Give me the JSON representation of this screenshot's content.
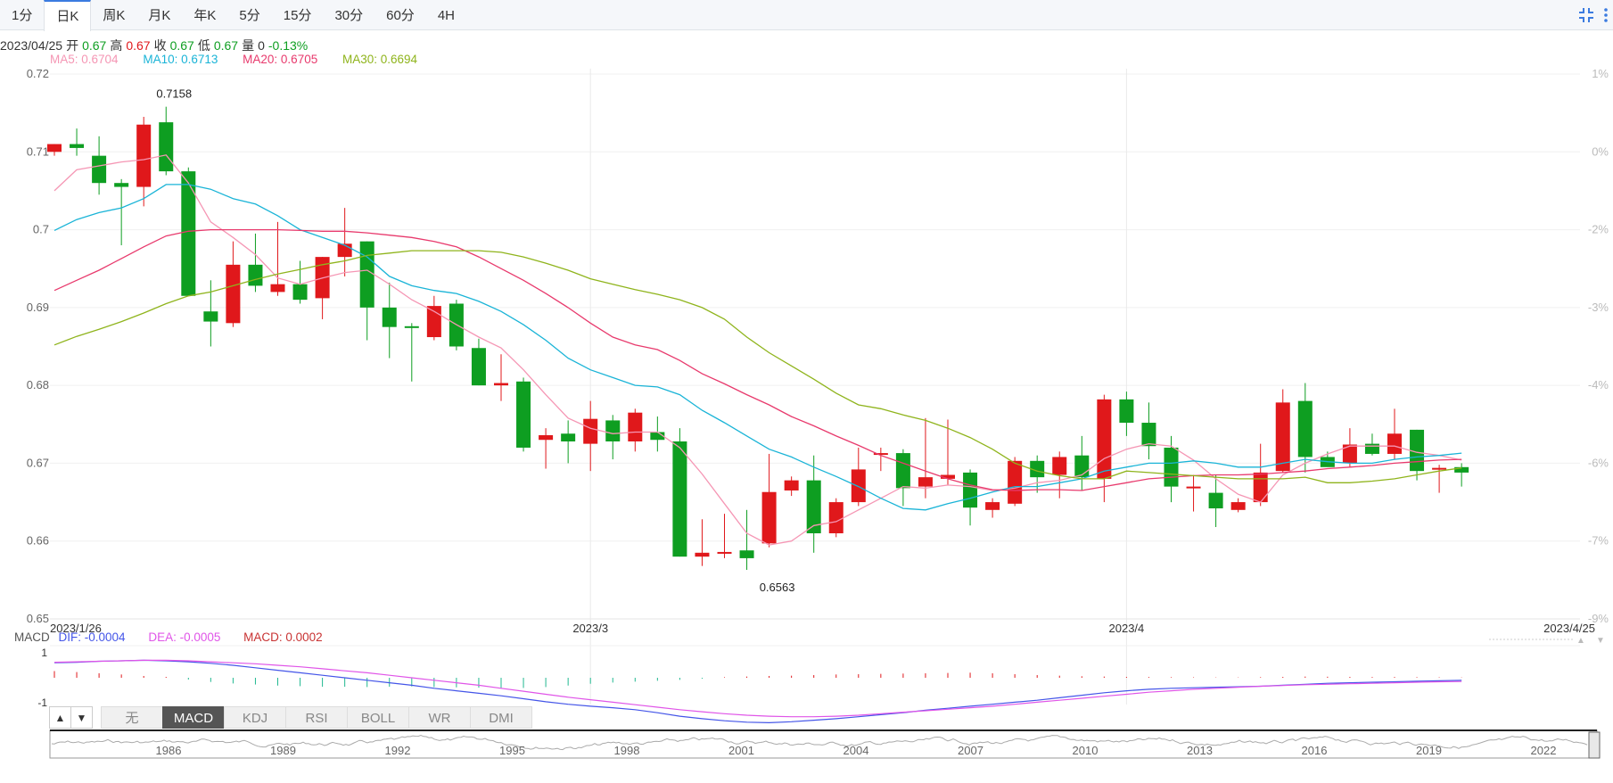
{
  "toolbar": {
    "tabs": [
      "1分",
      "日K",
      "周K",
      "月K",
      "年K",
      "5分",
      "15分",
      "30分",
      "60分",
      "4H"
    ],
    "active": "日K",
    "icons": [
      "collapse-icon",
      "more-icon"
    ]
  },
  "info": {
    "date": "2023/04/25",
    "open_label": "开",
    "open": "0.67",
    "high_label": "高",
    "high": "0.67",
    "close_label": "收",
    "close": "0.67",
    "low_label": "低",
    "low": "0.67",
    "vol_label": "量",
    "vol": "0",
    "change": "-0.13%"
  },
  "ma": {
    "ma5": "MA5: 0.6704",
    "ma10": "MA10: 0.6713",
    "ma20": "MA20: 0.6705",
    "ma30": "MA30: 0.6694"
  },
  "colors": {
    "up": "#e0181b",
    "down": "#0e9e21",
    "ma5": "#f596b4",
    "ma10": "#1ab4d7",
    "ma20": "#e83a6d",
    "ma30": "#8fb41c",
    "dif": "#4455e8",
    "dea": "#e055e8",
    "macd_label": "#c83232"
  },
  "macd": {
    "title": "MACD",
    "dif": "DIF: -0.0004",
    "dea": "DEA: -0.0005",
    "macd": "MACD: 0.0002",
    "yticks": [
      "1",
      "-1"
    ]
  },
  "indicators": {
    "buttons": [
      "无",
      "MACD",
      "KDJ",
      "RSI",
      "BOLL",
      "WR",
      "DMI"
    ],
    "active": "MACD",
    "arrows": [
      "▲",
      "▼"
    ]
  },
  "navigator": {
    "labels": [
      "1986",
      "1989",
      "1992",
      "1995",
      "1998",
      "2001",
      "2004",
      "2007",
      "2010",
      "2013",
      "2016",
      "2019",
      "2022"
    ]
  },
  "chart_data": {
    "type": "candlestick",
    "yticks": [
      "0.72",
      "0.71",
      "0.7",
      "0.69",
      "0.68",
      "0.67",
      "0.66",
      "0.65"
    ],
    "ylim": [
      0.65,
      0.72
    ],
    "right_ticks": [
      "1%",
      "0%",
      "-2%",
      "-3%",
      "-4%",
      "-6%",
      "-7%",
      "-9%"
    ],
    "xticks": [
      {
        "i": 0,
        "label": "2023/1/26"
      },
      {
        "i": 24,
        "label": "2023/3"
      },
      {
        "i": 48,
        "label": "2023/4"
      },
      {
        "i": 66,
        "label": "2023/4/25"
      }
    ],
    "annotations": [
      {
        "i": 5,
        "value": 0.7158,
        "label": "0.7158",
        "pos": "above"
      },
      {
        "i": 32,
        "value": 0.6563,
        "label": "0.6563",
        "pos": "below"
      }
    ],
    "candles": [
      [
        0.71,
        0.711,
        0.7095,
        0.711
      ],
      [
        0.711,
        0.713,
        0.7095,
        0.7105
      ],
      [
        0.7095,
        0.712,
        0.7045,
        0.706
      ],
      [
        0.706,
        0.7065,
        0.698,
        0.7055
      ],
      [
        0.7055,
        0.7145,
        0.703,
        0.7135
      ],
      [
        0.7138,
        0.7158,
        0.707,
        0.7075
      ],
      [
        0.7075,
        0.708,
        0.6915,
        0.6915
      ],
      [
        0.6895,
        0.6935,
        0.685,
        0.6882
      ],
      [
        0.688,
        0.6985,
        0.6875,
        0.6955
      ],
      [
        0.6955,
        0.6995,
        0.692,
        0.6928
      ],
      [
        0.692,
        0.701,
        0.6915,
        0.693
      ],
      [
        0.693,
        0.696,
        0.6905,
        0.691
      ],
      [
        0.6912,
        0.6965,
        0.6885,
        0.6965
      ],
      [
        0.6965,
        0.7028,
        0.694,
        0.6982
      ],
      [
        0.6985,
        0.6985,
        0.6858,
        0.69
      ],
      [
        0.69,
        0.6932,
        0.6835,
        0.6875
      ],
      [
        0.6876,
        0.688,
        0.6805,
        0.6875
      ],
      [
        0.6862,
        0.6915,
        0.6858,
        0.6902
      ],
      [
        0.6905,
        0.691,
        0.6845,
        0.685
      ],
      [
        0.6848,
        0.686,
        0.68,
        0.68
      ],
      [
        0.68,
        0.684,
        0.678,
        0.6803
      ],
      [
        0.6805,
        0.681,
        0.6715,
        0.672
      ],
      [
        0.673,
        0.6745,
        0.6693,
        0.6736
      ],
      [
        0.6738,
        0.6755,
        0.67,
        0.6728
      ],
      [
        0.6725,
        0.678,
        0.669,
        0.6757
      ],
      [
        0.6755,
        0.6762,
        0.6705,
        0.6728
      ],
      [
        0.6728,
        0.677,
        0.6715,
        0.6765
      ],
      [
        0.674,
        0.676,
        0.6715,
        0.673
      ],
      [
        0.6728,
        0.6745,
        0.658,
        0.658
      ],
      [
        0.658,
        0.6628,
        0.6568,
        0.6585
      ],
      [
        0.6585,
        0.6635,
        0.6578,
        0.6586
      ],
      [
        0.6588,
        0.664,
        0.6563,
        0.6578
      ],
      [
        0.6597,
        0.6712,
        0.6592,
        0.6663
      ],
      [
        0.6665,
        0.6683,
        0.6658,
        0.6678
      ],
      [
        0.6678,
        0.671,
        0.6585,
        0.661
      ],
      [
        0.661,
        0.6655,
        0.6605,
        0.665
      ],
      [
        0.665,
        0.672,
        0.6645,
        0.6692
      ],
      [
        0.6711,
        0.672,
        0.669,
        0.6713
      ],
      [
        0.6713,
        0.6718,
        0.6645,
        0.6668
      ],
      [
        0.667,
        0.6758,
        0.6655,
        0.6682
      ],
      [
        0.668,
        0.6756,
        0.6672,
        0.6685
      ],
      [
        0.6688,
        0.6692,
        0.662,
        0.6643
      ],
      [
        0.664,
        0.6655,
        0.663,
        0.665
      ],
      [
        0.6648,
        0.6708,
        0.6645,
        0.6703
      ],
      [
        0.6703,
        0.671,
        0.6662,
        0.6682
      ],
      [
        0.6685,
        0.6715,
        0.6655,
        0.6708
      ],
      [
        0.671,
        0.6735,
        0.6665,
        0.6682
      ],
      [
        0.668,
        0.6788,
        0.665,
        0.6782
      ],
      [
        0.6782,
        0.6792,
        0.6735,
        0.6752
      ],
      [
        0.6752,
        0.6778,
        0.6705,
        0.6722
      ],
      [
        0.672,
        0.6735,
        0.665,
        0.667
      ],
      [
        0.667,
        0.6685,
        0.6638,
        0.667
      ],
      [
        0.6662,
        0.6685,
        0.6618,
        0.6642
      ],
      [
        0.664,
        0.6655,
        0.6637,
        0.665
      ],
      [
        0.665,
        0.6725,
        0.6645,
        0.6688
      ],
      [
        0.669,
        0.6795,
        0.6688,
        0.6778
      ],
      [
        0.678,
        0.6803,
        0.6688,
        0.6708
      ],
      [
        0.6708,
        0.6715,
        0.67,
        0.6695
      ],
      [
        0.67,
        0.6745,
        0.6695,
        0.6724
      ],
      [
        0.6725,
        0.6738,
        0.671,
        0.6712
      ],
      [
        0.6712,
        0.677,
        0.6705,
        0.6738
      ],
      [
        0.6743,
        0.6743,
        0.6678,
        0.669
      ],
      [
        0.6694,
        0.6698,
        0.6662,
        0.6694
      ],
      [
        0.6695,
        0.67,
        0.667,
        0.6688
      ]
    ],
    "series": [
      {
        "name": "MA5",
        "values": [
          0.705,
          0.7077,
          0.7082,
          0.7087,
          0.709,
          0.7096,
          0.706,
          0.701,
          0.699,
          0.6968,
          0.6938,
          0.693,
          0.6938,
          0.6945,
          0.6948,
          0.693,
          0.691,
          0.6895,
          0.6878,
          0.6862,
          0.6848,
          0.682,
          0.6788,
          0.6758,
          0.6745,
          0.6738,
          0.674,
          0.674,
          0.672,
          0.6686,
          0.6648,
          0.661,
          0.6595,
          0.66,
          0.662,
          0.6625,
          0.664,
          0.6655,
          0.667,
          0.6668,
          0.6672,
          0.667,
          0.6665,
          0.6668,
          0.6675,
          0.6678,
          0.6685,
          0.6706,
          0.6718,
          0.6725,
          0.6722,
          0.6704,
          0.668,
          0.666,
          0.665,
          0.6685,
          0.67,
          0.6712,
          0.6722,
          0.6722,
          0.6722,
          0.6714,
          0.671,
          0.6704
        ]
      },
      {
        "name": "MA10",
        "values": [
          0.6999,
          0.7013,
          0.7022,
          0.7028,
          0.704,
          0.7058,
          0.7058,
          0.7052,
          0.704,
          0.7033,
          0.7018,
          0.7,
          0.699,
          0.698,
          0.6965,
          0.694,
          0.6928,
          0.6922,
          0.6918,
          0.6908,
          0.6895,
          0.6878,
          0.6858,
          0.6835,
          0.682,
          0.681,
          0.68,
          0.6798,
          0.6788,
          0.6768,
          0.6752,
          0.6735,
          0.6718,
          0.6708,
          0.6695,
          0.6683,
          0.667,
          0.6655,
          0.6642,
          0.664,
          0.6648,
          0.6655,
          0.6663,
          0.667,
          0.667,
          0.6675,
          0.668,
          0.669,
          0.6695,
          0.67,
          0.67,
          0.6703,
          0.67,
          0.6695,
          0.6695,
          0.67,
          0.6705,
          0.6702,
          0.67,
          0.67,
          0.6705,
          0.6708,
          0.671,
          0.6713
        ]
      },
      {
        "name": "MA20",
        "values": [
          0.6922,
          0.6935,
          0.6948,
          0.6963,
          0.6978,
          0.6992,
          0.6998,
          0.7,
          0.7,
          0.7,
          0.7,
          0.6999,
          0.6998,
          0.6998,
          0.6996,
          0.6993,
          0.699,
          0.6985,
          0.6978,
          0.6965,
          0.695,
          0.6935,
          0.6918,
          0.69,
          0.688,
          0.6862,
          0.6852,
          0.6846,
          0.6832,
          0.6815,
          0.6802,
          0.6788,
          0.6775,
          0.676,
          0.6748,
          0.6735,
          0.6723,
          0.671,
          0.67,
          0.669,
          0.668,
          0.6672,
          0.6666,
          0.6665,
          0.6666,
          0.6666,
          0.6665,
          0.667,
          0.6675,
          0.668,
          0.6682,
          0.6684,
          0.6685,
          0.6685,
          0.6686,
          0.6688,
          0.669,
          0.6693,
          0.6695,
          0.6697,
          0.67,
          0.6702,
          0.6704,
          0.6705
        ]
      },
      {
        "name": "MA30",
        "values": [
          0.6852,
          0.6863,
          0.6872,
          0.6882,
          0.6893,
          0.6905,
          0.6915,
          0.692,
          0.6928,
          0.6936,
          0.6943,
          0.6949,
          0.6955,
          0.696,
          0.6967,
          0.697,
          0.6973,
          0.6973,
          0.6973,
          0.6973,
          0.6971,
          0.6965,
          0.6957,
          0.6948,
          0.6937,
          0.693,
          0.6923,
          0.6917,
          0.691,
          0.69,
          0.6885,
          0.6862,
          0.6842,
          0.6825,
          0.6808,
          0.679,
          0.6775,
          0.677,
          0.6762,
          0.6755,
          0.6745,
          0.6733,
          0.6718,
          0.67,
          0.669,
          0.6684,
          0.668,
          0.668,
          0.669,
          0.6688,
          0.6686,
          0.6684,
          0.6682,
          0.668,
          0.668,
          0.668,
          0.6682,
          0.6675,
          0.6675,
          0.6677,
          0.668,
          0.6685,
          0.669,
          0.6694
        ]
      }
    ],
    "macd": {
      "hist": [
        0.45,
        0.38,
        0.3,
        0.22,
        0.12,
        0.06,
        -0.12,
        -0.28,
        -0.38,
        -0.45,
        -0.52,
        -0.56,
        -0.6,
        -0.6,
        -0.62,
        -0.6,
        -0.58,
        -0.62,
        -0.64,
        -0.66,
        -0.68,
        -0.68,
        -0.62,
        -0.52,
        -0.4,
        -0.32,
        -0.26,
        -0.2,
        -0.14,
        -0.06,
        0.04,
        0.08,
        0.12,
        0.14,
        0.18,
        0.22,
        0.24,
        0.26,
        0.28,
        0.3,
        0.32,
        0.34,
        0.3,
        0.24,
        0.18,
        0.14,
        0.1,
        0.08,
        0.06,
        0.05,
        0.04,
        0.03,
        0.02,
        0.02,
        0.04,
        0.06,
        0.08,
        0.07,
        0.06,
        0.05,
        0.05,
        0.04,
        0.03,
        0.02
      ],
      "dif": [
        0.6,
        0.62,
        0.66,
        0.68,
        0.7,
        0.68,
        0.64,
        0.58,
        0.5,
        0.4,
        0.3,
        0.2,
        0.1,
        0.0,
        -0.1,
        -0.2,
        -0.3,
        -0.42,
        -0.52,
        -0.62,
        -0.72,
        -0.84,
        -0.96,
        -1.06,
        -1.14,
        -1.2,
        -1.28,
        -1.4,
        -1.54,
        -1.64,
        -1.72,
        -1.78,
        -1.8,
        -1.76,
        -1.7,
        -1.64,
        -1.56,
        -1.48,
        -1.4,
        -1.3,
        -1.22,
        -1.14,
        -1.06,
        -0.98,
        -0.9,
        -0.8,
        -0.7,
        -0.6,
        -0.52,
        -0.46,
        -0.42,
        -0.4,
        -0.38,
        -0.36,
        -0.34,
        -0.3,
        -0.26,
        -0.22,
        -0.2,
        -0.18,
        -0.16,
        -0.14,
        -0.12,
        -0.1
      ],
      "dea": [
        0.62,
        0.64,
        0.66,
        0.68,
        0.7,
        0.7,
        0.68,
        0.64,
        0.6,
        0.56,
        0.5,
        0.44,
        0.36,
        0.28,
        0.2,
        0.1,
        0.0,
        -0.1,
        -0.2,
        -0.3,
        -0.42,
        -0.54,
        -0.66,
        -0.78,
        -0.88,
        -0.98,
        -1.08,
        -1.18,
        -1.28,
        -1.36,
        -1.44,
        -1.5,
        -1.54,
        -1.56,
        -1.56,
        -1.54,
        -1.5,
        -1.44,
        -1.38,
        -1.32,
        -1.26,
        -1.2,
        -1.14,
        -1.06,
        -0.98,
        -0.9,
        -0.82,
        -0.74,
        -0.66,
        -0.58,
        -0.52,
        -0.46,
        -0.42,
        -0.38,
        -0.34,
        -0.31,
        -0.28,
        -0.26,
        -0.24,
        -0.22,
        -0.2,
        -0.18,
        -0.16,
        -0.15
      ]
    }
  }
}
